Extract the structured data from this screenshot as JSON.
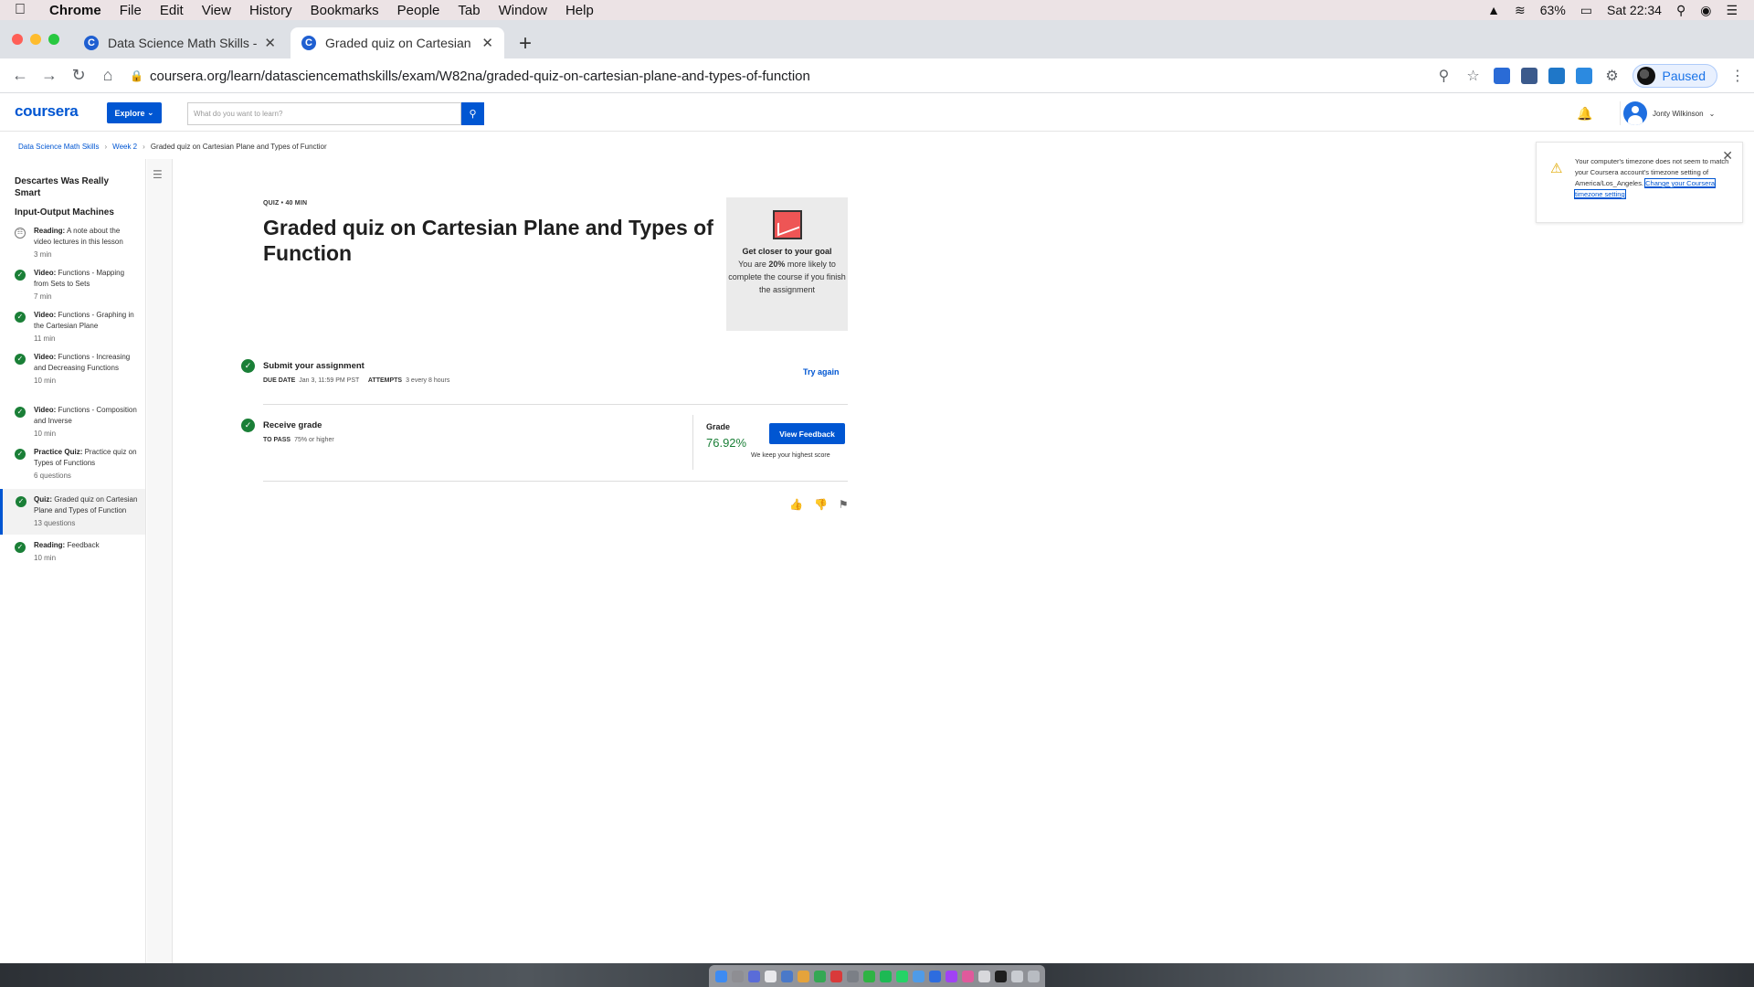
{
  "menubar": {
    "app": "Chrome",
    "items": [
      "File",
      "Edit",
      "View",
      "History",
      "Bookmarks",
      "People",
      "Tab",
      "Window",
      "Help"
    ],
    "battery": "63%",
    "clock": "Sat 22:34"
  },
  "tabs": [
    {
      "title": "Data Science Math Skills - Buil",
      "active": false
    },
    {
      "title": "Graded quiz on Cartesian Plane",
      "active": true
    }
  ],
  "toolbar": {
    "url": "coursera.org/learn/datasciencemathskills/exam/W82na/graded-quiz-on-cartesian-plane-and-types-of-function",
    "profile_status": "Paused"
  },
  "header": {
    "logo": "coursera",
    "explore": "Explore",
    "search_placeholder": "What do you want to learn?",
    "user_name": "Jonty Wilkinson"
  },
  "breadcrumb": {
    "course": "Data Science Math Skills",
    "week": "Week 2",
    "page": "Graded quiz on Cartesian Plane and Types of Functior"
  },
  "sidebar": {
    "module_title": "Descartes Was Really Smart",
    "section_title": "Input-Output Machines",
    "items": [
      {
        "type": "Reading:",
        "title": "A note about the video lectures in this lesson",
        "duration": "3 min",
        "done": false
      },
      {
        "type": "Video:",
        "title": "Functions - Mapping from Sets to Sets",
        "duration": "7 min",
        "done": true
      },
      {
        "type": "Video:",
        "title": "Functions - Graphing in the Cartesian Plane",
        "duration": "11 min",
        "done": true
      },
      {
        "type": "Video:",
        "title": "Functions - Increasing and Decreasing Functions",
        "duration": "10 min",
        "done": true
      },
      {
        "type": "Video:",
        "title": "Functions - Composition and Inverse",
        "duration": "10 min",
        "done": true
      },
      {
        "type": "Practice Quiz:",
        "title": "Practice quiz on Types of Functions",
        "duration": "6 questions",
        "done": true
      },
      {
        "type": "Quiz:",
        "title": "Graded quiz on Cartesian Plane and Types of Function",
        "duration": "13 questions",
        "done": true,
        "active": true
      },
      {
        "type": "Reading:",
        "title": "Feedback",
        "duration": "10 min",
        "done": true
      }
    ]
  },
  "quiz": {
    "meta": "QUIZ • 40 MIN",
    "title": "Graded quiz on Cartesian Plane and Types of Function",
    "goal_title": "Get closer to your goal",
    "goal_pre": "You are ",
    "goal_pct": "20%",
    "goal_post": " more likely to complete the course if you finish the assignment",
    "submit": {
      "title": "Submit your assignment",
      "due_label": "DUE DATE",
      "due_value": "Jan 3, 11:59 PM PST",
      "attempts_label": "ATTEMPTS",
      "attempts_value": "3 every 8 hours",
      "action": "Try again"
    },
    "receive": {
      "title": "Receive grade",
      "pass_label": "TO PASS",
      "pass_value": "75% or higher",
      "grade_label": "Grade",
      "grade_value": "76.92%",
      "feedback_button": "View Feedback",
      "keep_note": "We keep your highest score"
    }
  },
  "toast": {
    "message": "Your computer's timezone does not seem to match your Coursera account's timezone setting of America/Los_Angeles.",
    "link": "Change your Coursera timezone setting"
  }
}
